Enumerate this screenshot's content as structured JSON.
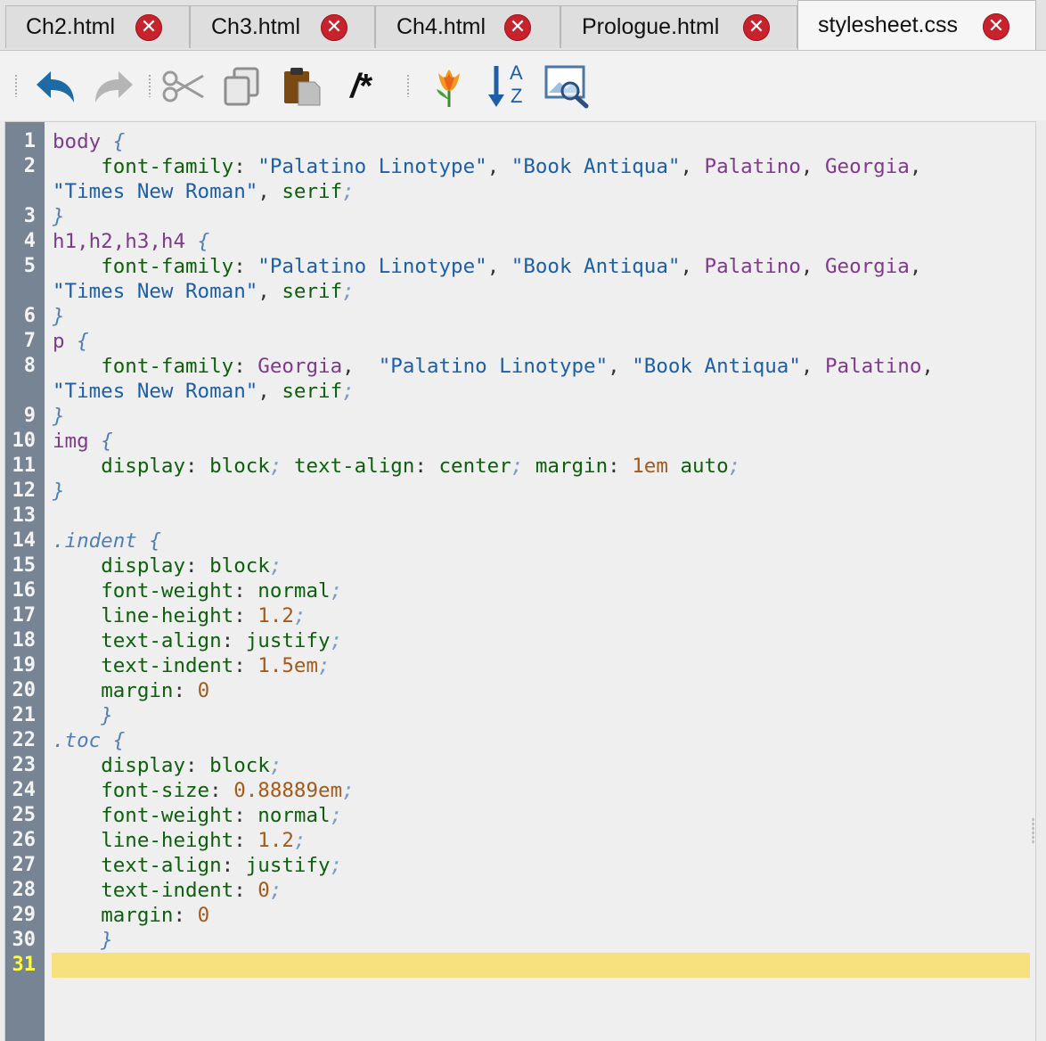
{
  "tabs": [
    {
      "label": "Ch2.html",
      "active": false
    },
    {
      "label": "Ch3.html",
      "active": false
    },
    {
      "label": "Ch4.html",
      "active": false
    },
    {
      "label": "Prologue.html",
      "active": false
    },
    {
      "label": "stylesheet.css",
      "active": true
    }
  ],
  "toolbar": {
    "buttons": [
      "undo-icon",
      "redo-icon",
      "cut-icon",
      "copy-icon",
      "paste-icon",
      "comment-icon",
      "tulip-icon",
      "sort-az-icon",
      "image-search-icon"
    ],
    "comment_glyph": "/*",
    "sort_a": "A",
    "sort_z": "Z"
  },
  "editor": {
    "current_line": 31,
    "lines": [
      {
        "n": "1",
        "segs": [
          [
            "sel",
            "body"
          ],
          [
            "pu",
            " "
          ],
          [
            "br",
            "{"
          ]
        ]
      },
      {
        "n": "2",
        "segs": [
          [
            "pu",
            "    "
          ],
          [
            "prop",
            "font-family"
          ],
          [
            "pu",
            ": "
          ],
          [
            "str",
            "\"Palatino Linotype\""
          ],
          [
            "pu",
            ", "
          ],
          [
            "str",
            "\"Book Antiqua\""
          ],
          [
            "pu",
            ", "
          ],
          [
            "fam",
            "Palatino"
          ],
          [
            "pu",
            ", "
          ],
          [
            "fam",
            "Georgia"
          ],
          [
            "pu",
            ","
          ]
        ]
      },
      {
        "n": "",
        "segs": [
          [
            "str",
            "\"Times New Roman\""
          ],
          [
            "pu",
            ", "
          ],
          [
            "prop",
            "serif"
          ],
          [
            "semi",
            ";"
          ]
        ]
      },
      {
        "n": "3",
        "segs": [
          [
            "br",
            "}"
          ]
        ]
      },
      {
        "n": "4",
        "segs": [
          [
            "sel",
            "h1,h2,h3,h4"
          ],
          [
            "pu",
            " "
          ],
          [
            "br",
            "{"
          ]
        ]
      },
      {
        "n": "5",
        "segs": [
          [
            "pu",
            "    "
          ],
          [
            "prop",
            "font-family"
          ],
          [
            "pu",
            ": "
          ],
          [
            "str",
            "\"Palatino Linotype\""
          ],
          [
            "pu",
            ", "
          ],
          [
            "str",
            "\"Book Antiqua\""
          ],
          [
            "pu",
            ", "
          ],
          [
            "fam",
            "Palatino"
          ],
          [
            "pu",
            ", "
          ],
          [
            "fam",
            "Georgia"
          ],
          [
            "pu",
            ","
          ]
        ]
      },
      {
        "n": "",
        "segs": [
          [
            "str",
            "\"Times New Roman\""
          ],
          [
            "pu",
            ", "
          ],
          [
            "prop",
            "serif"
          ],
          [
            "semi",
            ";"
          ]
        ]
      },
      {
        "n": "6",
        "segs": [
          [
            "br",
            "}"
          ]
        ]
      },
      {
        "n": "7",
        "segs": [
          [
            "sel",
            "p"
          ],
          [
            "pu",
            " "
          ],
          [
            "br",
            "{"
          ]
        ]
      },
      {
        "n": "8",
        "segs": [
          [
            "pu",
            "    "
          ],
          [
            "prop",
            "font-family"
          ],
          [
            "pu",
            ": "
          ],
          [
            "fam",
            "Georgia"
          ],
          [
            "pu",
            ",  "
          ],
          [
            "str",
            "\"Palatino Linotype\""
          ],
          [
            "pu",
            ", "
          ],
          [
            "str",
            "\"Book Antiqua\""
          ],
          [
            "pu",
            ", "
          ],
          [
            "fam",
            "Palatino"
          ],
          [
            "pu",
            ","
          ]
        ]
      },
      {
        "n": "",
        "segs": [
          [
            "str",
            "\"Times New Roman\""
          ],
          [
            "pu",
            ", "
          ],
          [
            "prop",
            "serif"
          ],
          [
            "semi",
            ";"
          ]
        ]
      },
      {
        "n": "9",
        "segs": [
          [
            "br",
            "}"
          ]
        ]
      },
      {
        "n": "10",
        "segs": [
          [
            "sel",
            "img"
          ],
          [
            "pu",
            " "
          ],
          [
            "br",
            "{"
          ]
        ]
      },
      {
        "n": "11",
        "segs": [
          [
            "pu",
            "    "
          ],
          [
            "prop",
            "display"
          ],
          [
            "pu",
            ": "
          ],
          [
            "prop",
            "block"
          ],
          [
            "semi",
            ";"
          ],
          [
            "pu",
            " "
          ],
          [
            "prop",
            "text-align"
          ],
          [
            "pu",
            ": "
          ],
          [
            "prop",
            "center"
          ],
          [
            "semi",
            ";"
          ],
          [
            "pu",
            " "
          ],
          [
            "prop",
            "margin"
          ],
          [
            "pu",
            ": "
          ],
          [
            "num",
            "1em"
          ],
          [
            "pu",
            " "
          ],
          [
            "prop",
            "auto"
          ],
          [
            "semi",
            ";"
          ]
        ]
      },
      {
        "n": "12",
        "segs": [
          [
            "br",
            "}"
          ]
        ]
      },
      {
        "n": "13",
        "segs": []
      },
      {
        "n": "14",
        "segs": [
          [
            "cls",
            ".indent"
          ],
          [
            "pu",
            " "
          ],
          [
            "br",
            "{"
          ]
        ]
      },
      {
        "n": "15",
        "segs": [
          [
            "pu",
            "    "
          ],
          [
            "prop",
            "display"
          ],
          [
            "pu",
            ": "
          ],
          [
            "prop",
            "block"
          ],
          [
            "semi",
            ";"
          ]
        ]
      },
      {
        "n": "16",
        "segs": [
          [
            "pu",
            "    "
          ],
          [
            "prop",
            "font-weight"
          ],
          [
            "pu",
            ": "
          ],
          [
            "prop",
            "normal"
          ],
          [
            "semi",
            ";"
          ]
        ]
      },
      {
        "n": "17",
        "segs": [
          [
            "pu",
            "    "
          ],
          [
            "prop",
            "line-height"
          ],
          [
            "pu",
            ": "
          ],
          [
            "num",
            "1.2"
          ],
          [
            "semi",
            ";"
          ]
        ]
      },
      {
        "n": "18",
        "segs": [
          [
            "pu",
            "    "
          ],
          [
            "prop",
            "text-align"
          ],
          [
            "pu",
            ": "
          ],
          [
            "prop",
            "justify"
          ],
          [
            "semi",
            ";"
          ]
        ]
      },
      {
        "n": "19",
        "segs": [
          [
            "pu",
            "    "
          ],
          [
            "prop",
            "text-indent"
          ],
          [
            "pu",
            ": "
          ],
          [
            "num",
            "1.5em"
          ],
          [
            "semi",
            ";"
          ]
        ]
      },
      {
        "n": "20",
        "segs": [
          [
            "pu",
            "    "
          ],
          [
            "prop",
            "margin"
          ],
          [
            "pu",
            ": "
          ],
          [
            "num",
            "0"
          ]
        ]
      },
      {
        "n": "21",
        "segs": [
          [
            "pu",
            "    "
          ],
          [
            "br",
            "}"
          ]
        ]
      },
      {
        "n": "22",
        "segs": [
          [
            "cls",
            ".toc"
          ],
          [
            "pu",
            " "
          ],
          [
            "br",
            "{"
          ]
        ]
      },
      {
        "n": "23",
        "segs": [
          [
            "pu",
            "    "
          ],
          [
            "prop",
            "display"
          ],
          [
            "pu",
            ": "
          ],
          [
            "prop",
            "block"
          ],
          [
            "semi",
            ";"
          ]
        ]
      },
      {
        "n": "24",
        "segs": [
          [
            "pu",
            "    "
          ],
          [
            "prop",
            "font-size"
          ],
          [
            "pu",
            ": "
          ],
          [
            "num",
            "0.88889em"
          ],
          [
            "semi",
            ";"
          ]
        ]
      },
      {
        "n": "25",
        "segs": [
          [
            "pu",
            "    "
          ],
          [
            "prop",
            "font-weight"
          ],
          [
            "pu",
            ": "
          ],
          [
            "prop",
            "normal"
          ],
          [
            "semi",
            ";"
          ]
        ]
      },
      {
        "n": "26",
        "segs": [
          [
            "pu",
            "    "
          ],
          [
            "prop",
            "line-height"
          ],
          [
            "pu",
            ": "
          ],
          [
            "num",
            "1.2"
          ],
          [
            "semi",
            ";"
          ]
        ]
      },
      {
        "n": "27",
        "segs": [
          [
            "pu",
            "    "
          ],
          [
            "prop",
            "text-align"
          ],
          [
            "pu",
            ": "
          ],
          [
            "prop",
            "justify"
          ],
          [
            "semi",
            ";"
          ]
        ]
      },
      {
        "n": "28",
        "segs": [
          [
            "pu",
            "    "
          ],
          [
            "prop",
            "text-indent"
          ],
          [
            "pu",
            ": "
          ],
          [
            "num",
            "0"
          ],
          [
            "semi",
            ";"
          ]
        ]
      },
      {
        "n": "29",
        "segs": [
          [
            "pu",
            "    "
          ],
          [
            "prop",
            "margin"
          ],
          [
            "pu",
            ": "
          ],
          [
            "num",
            "0"
          ]
        ]
      },
      {
        "n": "30",
        "segs": [
          [
            "pu",
            "    "
          ],
          [
            "br",
            "}"
          ]
        ]
      },
      {
        "n": "31",
        "segs": []
      }
    ]
  }
}
